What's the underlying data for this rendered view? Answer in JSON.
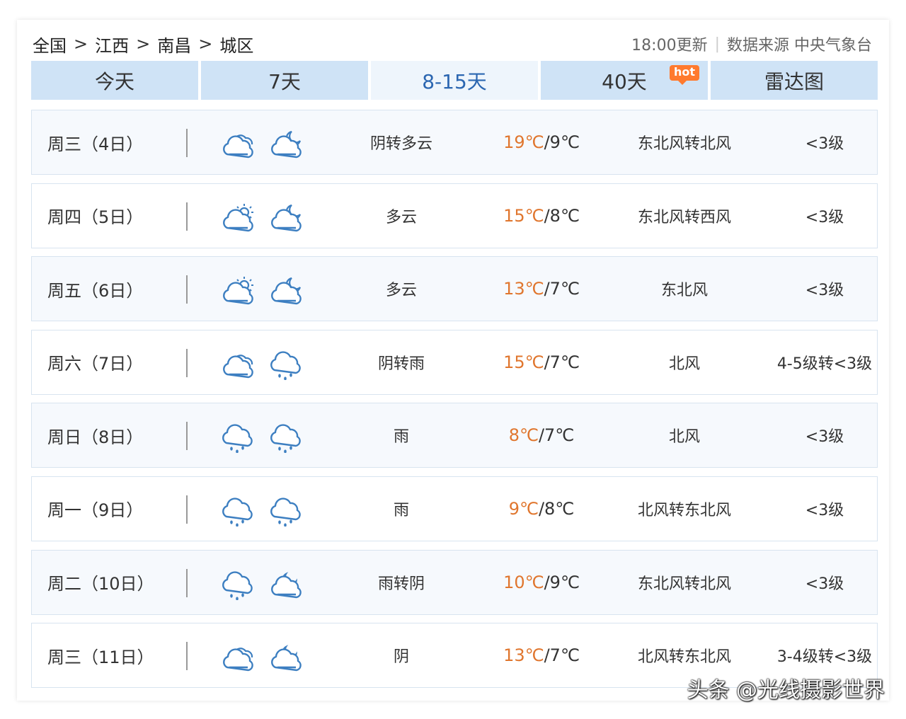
{
  "breadcrumb": {
    "items": [
      "全国",
      "江西",
      "南昌",
      "城区"
    ],
    "separator": ">"
  },
  "meta": {
    "update": "18:00更新",
    "source": "数据来源 中央气象台"
  },
  "tabs": [
    {
      "label": "今天"
    },
    {
      "label": "7天"
    },
    {
      "label": "8-15天"
    },
    {
      "label": "40天",
      "badge": "hot"
    },
    {
      "label": "雷达图"
    }
  ],
  "active_tab": "8-15天",
  "colors": {
    "tab_bg": "#cfe3f6",
    "tab_active_text": "#2b66b1",
    "temp_high": "#e0762e",
    "icon_stroke": "#3d7fc1",
    "hot_badge": "#ff7a2e"
  },
  "forecast": [
    {
      "day": "周三（4日）",
      "icons": [
        "cloudy-icon",
        "partly-cloudy-night-icon"
      ],
      "desc": "阴转多云",
      "high": "19℃",
      "low": "/9℃",
      "wind": "东北风转北风",
      "level": "<3级"
    },
    {
      "day": "周四（5日）",
      "icons": [
        "partly-cloudy-day-icon",
        "partly-cloudy-night-icon"
      ],
      "desc": "多云",
      "high": "15℃",
      "low": "/8℃",
      "wind": "东北风转西风",
      "level": "<3级"
    },
    {
      "day": "周五（6日）",
      "icons": [
        "partly-cloudy-day-icon",
        "partly-cloudy-night-icon"
      ],
      "desc": "多云",
      "high": "13℃",
      "low": "/7℃",
      "wind": "东北风",
      "level": "<3级"
    },
    {
      "day": "周六（7日）",
      "icons": [
        "cloudy-icon",
        "rain-icon"
      ],
      "desc": "阴转雨",
      "high": "15℃",
      "low": "/7℃",
      "wind": "北风",
      "level": "4-5级转<3级"
    },
    {
      "day": "周日（8日）",
      "icons": [
        "rain-icon",
        "rain-icon"
      ],
      "desc": "雨",
      "high": "8℃",
      "low": "/7℃",
      "wind": "北风",
      "level": "<3级"
    },
    {
      "day": "周一（9日）",
      "icons": [
        "rain-icon",
        "rain-icon"
      ],
      "desc": "雨",
      "high": "9℃",
      "low": "/8℃",
      "wind": "北风转东北风",
      "level": "<3级"
    },
    {
      "day": "周二（10日）",
      "icons": [
        "rain-icon",
        "moon-cloud-icon"
      ],
      "desc": "雨转阴",
      "high": "10℃",
      "low": "/9℃",
      "wind": "东北风转北风",
      "level": "<3级"
    },
    {
      "day": "周三（11日）",
      "icons": [
        "cloudy-icon",
        "moon-cloud-icon"
      ],
      "desc": "阴",
      "high": "13℃",
      "low": "/7℃",
      "wind": "北风转东北风",
      "level": "3-4级转<3级"
    }
  ],
  "watermark": "头条 @光线摄影世界"
}
